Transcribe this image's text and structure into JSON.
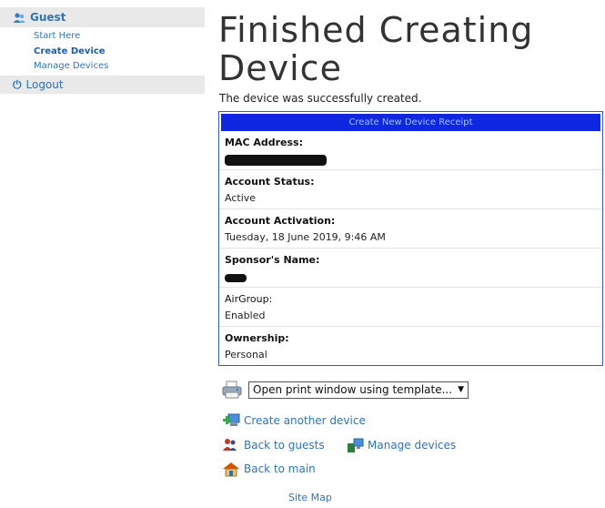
{
  "sidebar": {
    "section_label": "Guest",
    "items": [
      {
        "label": "Start Here"
      },
      {
        "label": "Create Device"
      },
      {
        "label": "Manage Devices"
      }
    ],
    "logout_label": "Logout"
  },
  "page": {
    "title": "Finished Creating Device",
    "message": "The device was successfully created."
  },
  "receipt": {
    "header": "Create New Device Receipt",
    "fields": [
      {
        "label": "MAC Address:",
        "value": "",
        "redacted": true
      },
      {
        "label": "Account Status:",
        "value": "Active"
      },
      {
        "label": "Account Activation:",
        "value": "Tuesday, 18 June 2019, 9:46 AM"
      },
      {
        "label": "Sponsor's Name:",
        "value": "",
        "redacted": true
      },
      {
        "label": "AirGroup:",
        "value": "Enabled"
      },
      {
        "label": "Ownership:",
        "value": "Personal"
      }
    ]
  },
  "actions": {
    "print_select": "Open print window using template...",
    "create_another": "Create another device",
    "back_to_guests": "Back to guests",
    "manage_devices": "Manage devices",
    "back_to_main": "Back to main"
  },
  "footer": {
    "site_map": "Site Map"
  },
  "colors": {
    "link": "#2f75b5",
    "receipt_header_bg": "#0f27e0",
    "sidebar_bg": "#e9e9e9"
  }
}
